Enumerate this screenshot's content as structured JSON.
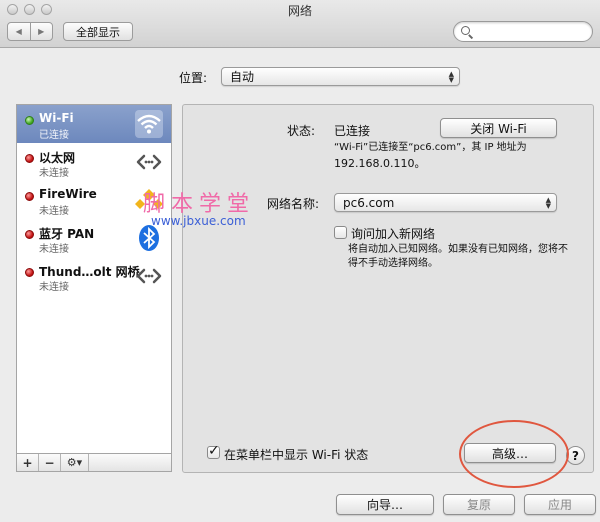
{
  "window": {
    "title": "网络"
  },
  "toolbar": {
    "back_glyph": "◀",
    "forward_glyph": "▶",
    "show_all": "全部显示",
    "search_placeholder": ""
  },
  "location": {
    "label": "位置:",
    "value": "自动"
  },
  "services": [
    {
      "name": "Wi-Fi",
      "status": "已连接",
      "state_color": "#3fa61f",
      "icon": "wifi-icon",
      "selected": true
    },
    {
      "name": "以太网",
      "status": "未连接",
      "state_color": "#c01010",
      "icon": "ethernet-icon",
      "selected": false
    },
    {
      "name": "FireWire",
      "status": "未连接",
      "state_color": "#c01010",
      "icon": "firewire-icon",
      "selected": false
    },
    {
      "name": "蓝牙 PAN",
      "status": "未连接",
      "state_color": "#c01010",
      "icon": "bluetooth-icon",
      "selected": false
    },
    {
      "name": "Thund…olt 网桥",
      "status": "未连接",
      "state_color": "#c01010",
      "icon": "thunderbolt-bridge-icon",
      "selected": false
    }
  ],
  "sidebar_footer": {
    "add": "+",
    "remove": "−",
    "gear": "⚙▾"
  },
  "detail": {
    "status_label": "状态:",
    "status_value": "已连接",
    "turn_off_button": "关闭 Wi-Fi",
    "status_desc_line1": "“Wi-Fi”已连接至“pc6.com”，其 IP 地址为",
    "status_desc_line2": "192.168.0.110。",
    "network_name_label": "网络名称:",
    "network_name_value": "pc6.com",
    "ask_join_label": "询问加入新网络",
    "ask_join_checked": false,
    "ask_join_desc_line1": "将自动加入已知网络。如果没有已知网络，您将不",
    "ask_join_desc_line2": "得不手动选择网络。",
    "show_menubar_label": "在菜单栏中显示 Wi-Fi 状态",
    "show_menubar_checked": true,
    "advanced_button": "高级…",
    "help_button": "?"
  },
  "bottom": {
    "assist": "向导…",
    "revert": "复原",
    "apply": "应用"
  },
  "watermark": {
    "cn": "脚本学堂",
    "url": "www.jbxue.com"
  },
  "colors": {
    "selection": "#7790c3",
    "highlight_ring": "#e0573f",
    "watermark_cn": "#f06aa8",
    "watermark_url": "#3b5fd6"
  }
}
